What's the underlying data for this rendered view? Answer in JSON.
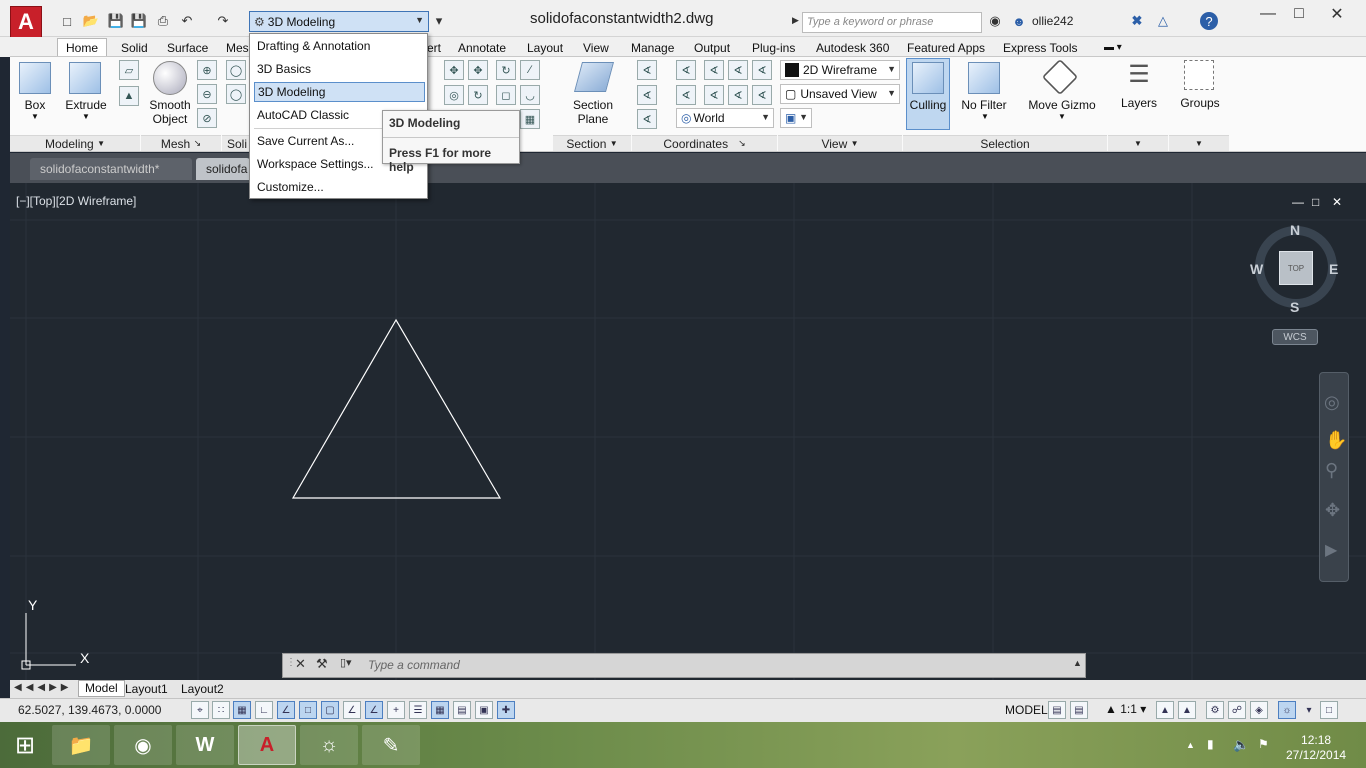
{
  "title_bar": {
    "app_logo_letter": "A",
    "document_title": "solidofaconstantwidth2.dwg",
    "workspace_selected": "3D Modeling",
    "search_placeholder": "Type a keyword or phrase",
    "user_name": "ollie242"
  },
  "ribbon_tabs": [
    "Home",
    "Solid",
    "Surface",
    "Mes",
    "ert",
    "Annotate",
    "Layout",
    "View",
    "Manage",
    "Output",
    "Plug-ins",
    "Autodesk 360",
    "Featured Apps",
    "Express Tools"
  ],
  "ribbon": {
    "box_label": "Box",
    "extrude_label": "Extrude",
    "smooth_object_label": "Smooth\nObject",
    "section_plane_label": "Section\nPlane",
    "culling_label": "Culling",
    "no_filter_label": "No Filter",
    "move_gizmo_label": "Move Gizmo",
    "layers_label": "Layers",
    "groups_label": "Groups",
    "visual_style": "2D Wireframe",
    "named_view": "Unsaved View",
    "ucs": "World",
    "panels": {
      "modeling": "Modeling",
      "mesh": "Mesh",
      "solid_editing": "Soli",
      "section": "Section",
      "coordinates": "Coordinates",
      "view": "View",
      "selection": "Selection"
    }
  },
  "workspace_menu": {
    "items": [
      "Drafting & Annotation",
      "3D Basics",
      "3D Modeling",
      "AutoCAD Classic",
      "Save Current As...",
      "Workspace Settings...",
      "Customize..."
    ],
    "selected": "3D Modeling"
  },
  "tooltip": {
    "title": "3D Modeling",
    "help": "Press F1 for more help"
  },
  "document_tabs": [
    "solidofaconstantwidth*",
    "solidofa"
  ],
  "viewport": {
    "label": "[−][Top][2D Wireframe]",
    "compass": {
      "n": "N",
      "s": "S",
      "e": "E",
      "w": "W"
    },
    "cube_face": "TOP",
    "wcs_label": "WCS",
    "ucs_y": "Y",
    "ucs_x": "X"
  },
  "command_line": {
    "placeholder": "Type a command"
  },
  "layout_tabs": [
    "Model",
    "Layout1",
    "Layout2"
  ],
  "status_bar": {
    "coordinates": "62.5027, 139.4673, 0.0000",
    "space": "MODEL",
    "scale": "1:1"
  },
  "taskbar": {
    "time": "12:18",
    "date": "27/12/2014"
  },
  "colors": {
    "canvas": "#212830",
    "accent": "#3e74b6",
    "autocad_red": "#c8202a"
  }
}
